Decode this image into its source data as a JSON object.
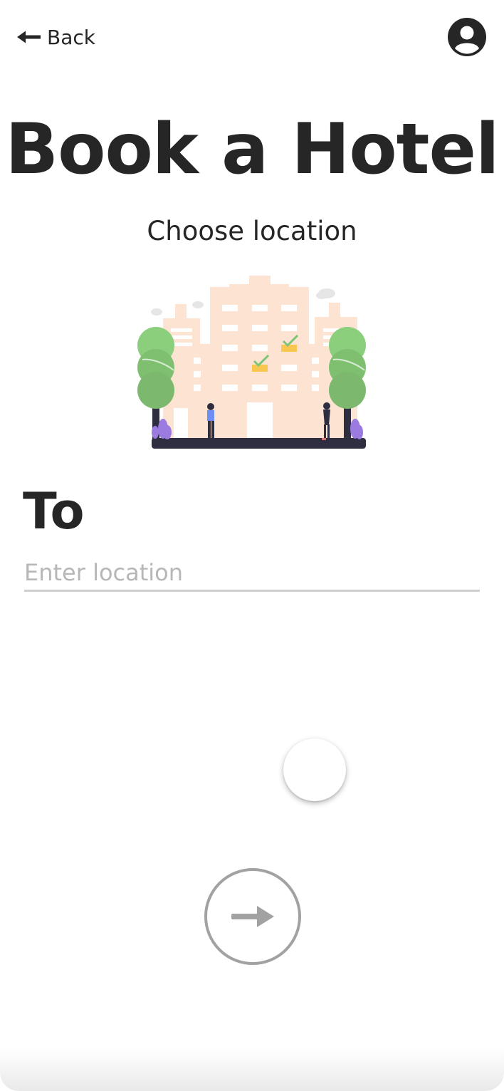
{
  "header": {
    "back_label": "Back",
    "back_icon": "arrow-left-icon",
    "profile_icon": "user-circle-icon"
  },
  "main": {
    "title": "Book a Hotel",
    "subtitle": "Choose location",
    "illustration": "hotel-building-illustration",
    "field_label": "To",
    "location_input": {
      "value": "",
      "placeholder": "Enter location"
    },
    "next_icon": "arrow-right-icon"
  },
  "colors": {
    "text": "#262626",
    "placeholder": "#b7b7b7",
    "underline": "#cfcfcf",
    "next_button_gray": "#a2a2a2",
    "building": "#fde3d2",
    "tree_green": "#8bcf7d",
    "ground": "#2f2e41"
  }
}
